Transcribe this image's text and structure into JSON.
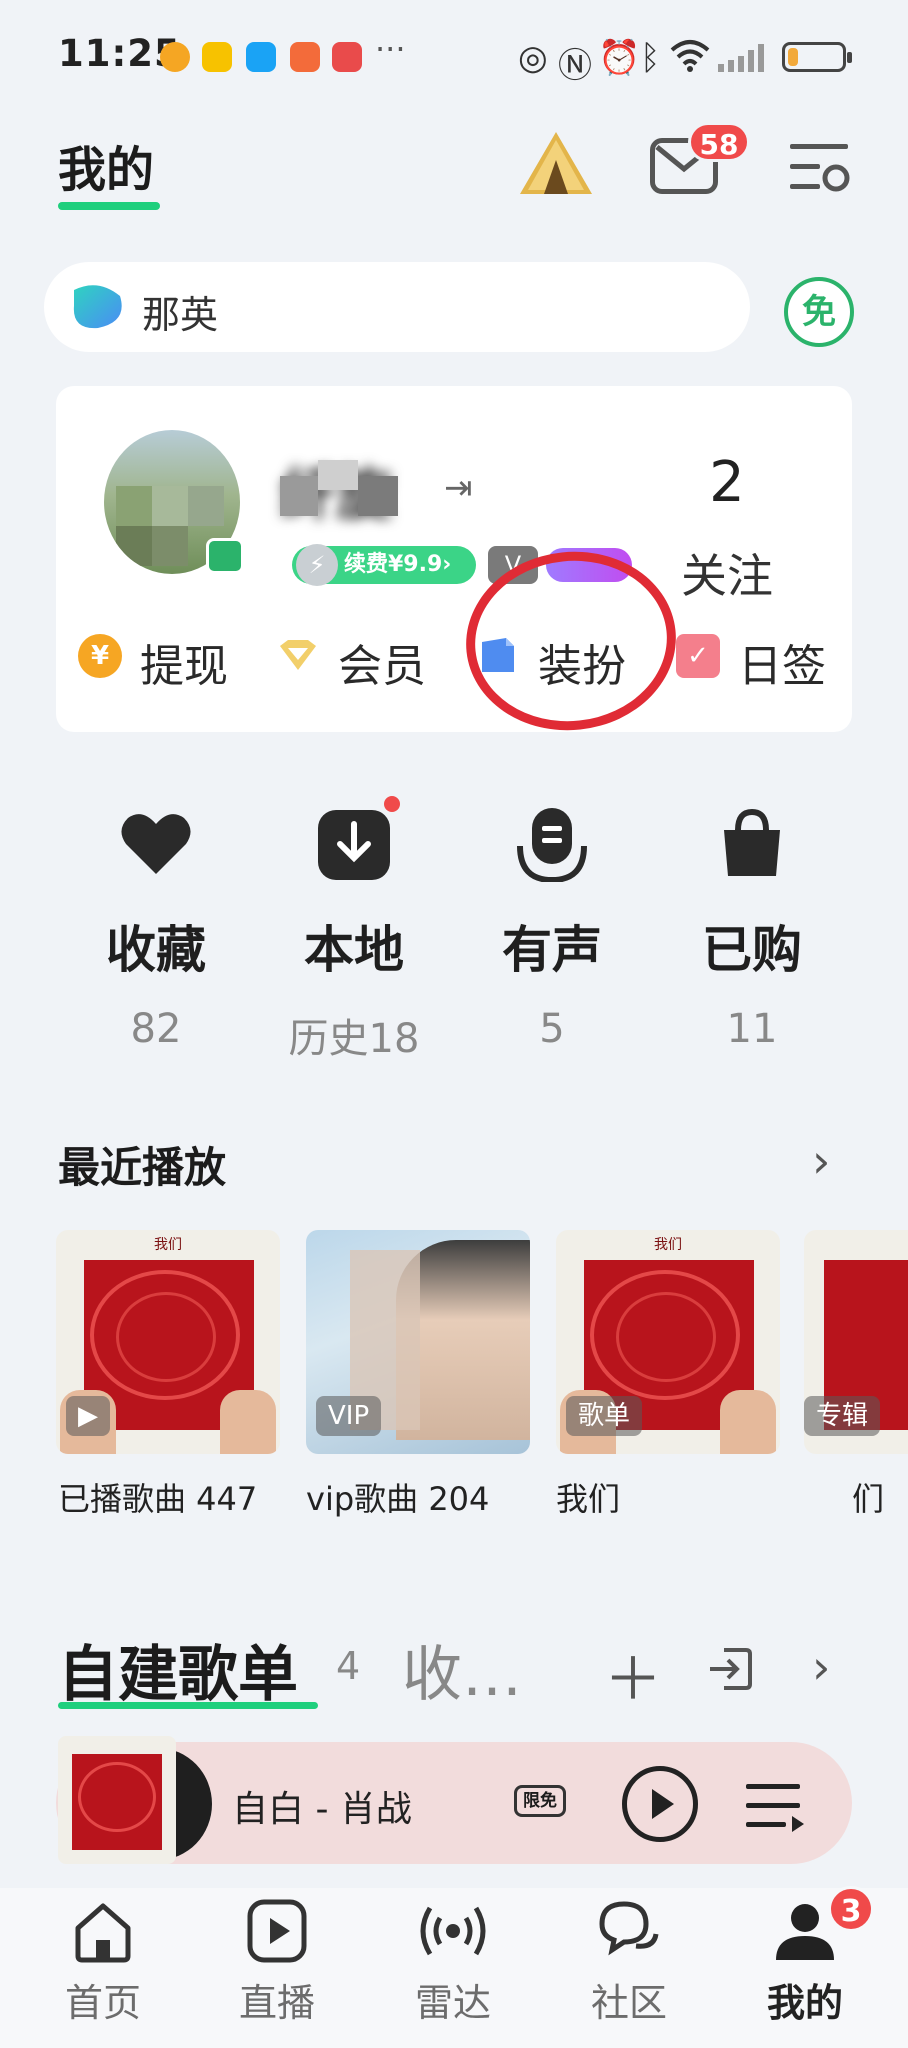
{
  "status_bar": {
    "time": "11:25",
    "more": "···",
    "battery_level": 0.2
  },
  "header": {
    "title": "我的",
    "mail_badge": "58"
  },
  "search": {
    "text": "那英",
    "free_badge": "免"
  },
  "profile": {
    "username": "纤旋",
    "follow_count": "2",
    "follow_label": "关注",
    "renew_badge": "续费¥9.9›",
    "vip_level": "V"
  },
  "quick_actions": [
    {
      "label": "提现",
      "icon": "yen-coin-icon",
      "color": "#f6a623"
    },
    {
      "label": "会员",
      "icon": "vip-diamond-icon",
      "color": "#f0c75a"
    },
    {
      "label": "装扮",
      "icon": "dress-up-icon",
      "color": "#4f8cf0"
    },
    {
      "label": "日签",
      "icon": "daily-sign-icon",
      "color": "#f47f8c"
    }
  ],
  "shortcuts": [
    {
      "label": "收藏",
      "count": "82",
      "icon": "heart-icon"
    },
    {
      "label": "本地",
      "count": "历史18",
      "icon": "download-icon"
    },
    {
      "label": "有声",
      "count": "5",
      "icon": "audiobook-icon"
    },
    {
      "label": "已购",
      "count": "11",
      "icon": "shopping-bag-icon"
    }
  ],
  "recent": {
    "title": "最近播放",
    "items": [
      {
        "caption": "已播歌曲 447",
        "badge": "▶"
      },
      {
        "caption": "vip歌曲 204",
        "badge": "VIP"
      },
      {
        "caption": "我们",
        "badge": "歌单"
      },
      {
        "caption": "们",
        "badge": "专辑"
      }
    ]
  },
  "playlist_tabs": {
    "mine": "自建歌单",
    "mine_count": "4",
    "collected": "收…"
  },
  "player": {
    "song": "自白 - 肖战",
    "badge": "限免"
  },
  "bottom_nav": {
    "items": [
      {
        "label": "首页",
        "icon": "home-icon"
      },
      {
        "label": "直播",
        "icon": "live-play-icon"
      },
      {
        "label": "雷达",
        "icon": "radar-icon"
      },
      {
        "label": "社区",
        "icon": "community-chat-icon"
      },
      {
        "label": "我的",
        "icon": "profile-icon"
      }
    ],
    "badge": "3"
  },
  "colors": {
    "accent_green": "#1fcf7d",
    "badge_red": "#f04a4a",
    "annotation_red": "#e02b35"
  }
}
